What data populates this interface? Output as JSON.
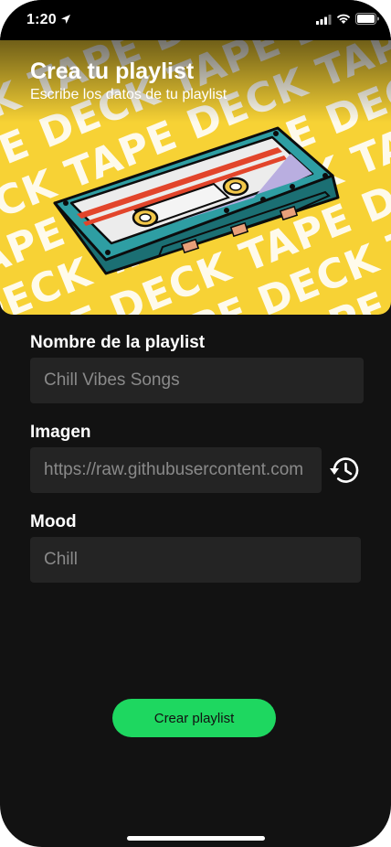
{
  "status_bar": {
    "time": "1:20",
    "icons": [
      "location-arrow-icon",
      "cellular-signal-icon",
      "wifi-icon",
      "battery-icon"
    ]
  },
  "hero": {
    "title": "Crea tu playlist",
    "subtitle": "Escribe los datos de tu playlist",
    "background_word_rows": [
      "DECK TAPE DECK TAPE DECK",
      "TAPE DECK TAPE DECK TAPE",
      "DECK TAPE DECK TAPE DECK",
      "TAPE DECK TAPE DECK TAPE",
      "DECK TAPE DECK TAPE DECK",
      "TAPE DECK TAPE DECK TAPE",
      "DECK TAPE DECK TAPE DECK",
      "TAPE DECK TAPE DECK TAPE"
    ],
    "image_icon": "cassette-tape-illustration",
    "colors": {
      "background": "#f7d235",
      "cassette_body": "#2e9ea3"
    }
  },
  "form": {
    "name": {
      "label": "Nombre de la playlist",
      "placeholder": "Chill Vibes Songs"
    },
    "image": {
      "label": "Imagen",
      "placeholder": "https://raw.githubusercontent.com",
      "history_icon": "history-icon"
    },
    "mood": {
      "label": "Mood",
      "placeholder": "Chill"
    }
  },
  "create_button": {
    "label": "Crear playlist",
    "color": "#1ed760"
  },
  "theme": {
    "background": "#121212",
    "input_background": "#242424"
  }
}
